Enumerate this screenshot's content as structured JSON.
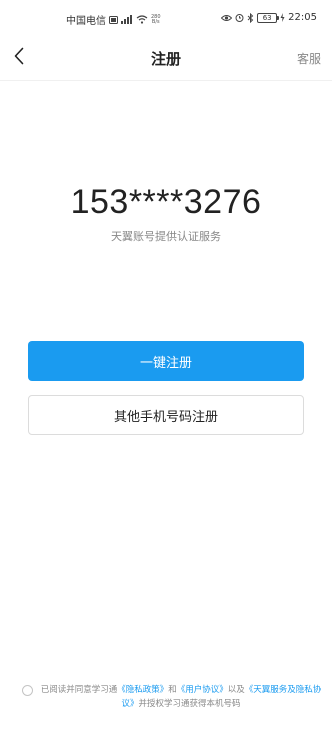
{
  "status_bar": {
    "carrier": "中国电信",
    "net_speed_value": "280",
    "net_speed_unit": "B/s",
    "battery": "63",
    "time": "22:05"
  },
  "header": {
    "title": "注册",
    "service_label": "客服"
  },
  "main": {
    "phone_number": "153****3276",
    "auth_note": "天翼账号提供认证服务",
    "primary_button": "一键注册",
    "secondary_button": "其他手机号码注册"
  },
  "agreement": {
    "prefix": "已阅读并同意学习通",
    "privacy_policy": "《隐私政策》",
    "and": "和",
    "user_agreement": "《用户协议》",
    "also": "以及",
    "tianyi_terms": "《天翼服务及隐私协议》",
    "suffix": "并授权学习通获得本机号码"
  },
  "colors": {
    "accent": "#1a9bf0",
    "text_primary": "#222222",
    "text_secondary": "#888888"
  },
  "icons": [
    "back-chevron-icon",
    "sim-icon",
    "signal-icon",
    "wifi-icon",
    "eye-icon",
    "alarm-icon",
    "bluetooth-icon",
    "battery-icon",
    "charging-icon"
  ]
}
